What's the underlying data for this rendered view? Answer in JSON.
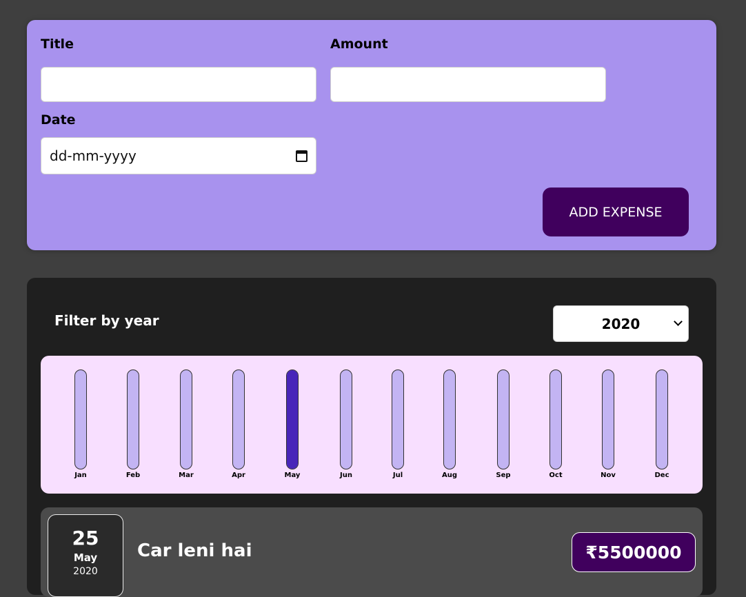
{
  "form": {
    "title_label": "Title",
    "title_value": "",
    "amount_label": "Amount",
    "amount_value": "",
    "date_label": "Date",
    "date_placeholder": "dd-mm-yyyy",
    "submit_label": "ADD EXPENSE"
  },
  "filter": {
    "label": "Filter by year",
    "selected_year": "2020"
  },
  "chart_data": {
    "type": "bar",
    "categories": [
      "Jan",
      "Feb",
      "Mar",
      "Apr",
      "May",
      "Jun",
      "Jul",
      "Aug",
      "Sep",
      "Oct",
      "Nov",
      "Dec"
    ],
    "values": [
      0,
      0,
      0,
      0,
      5500000,
      0,
      0,
      0,
      0,
      0,
      0,
      0
    ],
    "ylim": [
      0,
      5500000
    ]
  },
  "expenses": [
    {
      "day": "25",
      "month": "May",
      "year": "2020",
      "title": "Car leni hai",
      "amount": "₹5500000"
    }
  ],
  "colors": {
    "accent": "#40005d",
    "form_bg": "#a892ee",
    "chart_bg": "#f8dfff",
    "bar_track": "#c3b4f3",
    "bar_fill": "#4826b9"
  },
  "icons": {
    "date_picker": "calendar-icon",
    "select": "chevron-down-icon"
  }
}
